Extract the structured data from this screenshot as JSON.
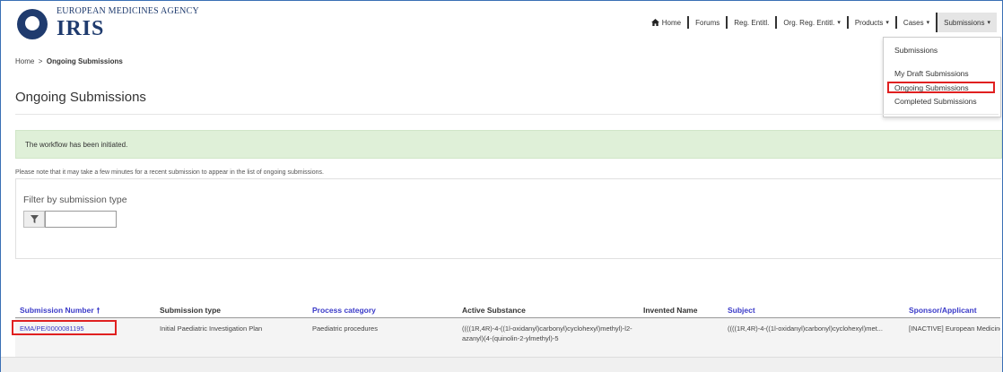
{
  "header": {
    "agency_name": "EUROPEAN MEDICINES AGENCY",
    "app_name": "IRIS"
  },
  "topnav": {
    "items": [
      {
        "label": "Home",
        "icon": "home-icon"
      },
      {
        "label": "Forums"
      },
      {
        "label": "Reg. Entitl."
      },
      {
        "label": "Org. Reg. Entitl.",
        "has_caret": true
      },
      {
        "label": "Products",
        "has_caret": true
      },
      {
        "label": "Cases",
        "has_caret": true
      },
      {
        "label": "Submissions",
        "has_caret": true,
        "active": true
      }
    ],
    "caret_glyph": "▾"
  },
  "submissions_menu": {
    "items": [
      "Submissions",
      "My Draft Submissions",
      "Ongoing Submissions",
      "Completed Submissions"
    ],
    "highlighted": "Ongoing Submissions"
  },
  "breadcrumb": {
    "home": "Home",
    "separator": ">",
    "current": "Ongoing Submissions"
  },
  "page": {
    "title": "Ongoing Submissions",
    "alert_message": "The workflow has been initiated.",
    "note": "Please note that it may take a few minutes for a recent submission to appear in the list of ongoing submissions."
  },
  "filter": {
    "label": "Filter by submission type",
    "input_value": "",
    "icon": "filter-icon"
  },
  "table": {
    "columns": [
      "Submission Number",
      "Submission type",
      "Process category",
      "Active Substance",
      "Invented Name",
      "Subject",
      "Sponsor/Applicant"
    ],
    "sort_indicator": "🠕",
    "sorted_column": "Submission Number",
    "rows": [
      {
        "submission_number": "EMA/PE/0000081195",
        "submission_type": "Initial Paediatric Investigation Plan",
        "process_category": "Paediatric procedures",
        "active_substance": "((((1R,4R)-4-((1l-oxidanyl)carbonyl)cyclohexyl)methyl)-l2-azanyl)(4-(quinolin-2-ylmethyl)-5",
        "invented_name": "",
        "subject": "((((1R,4R)-4-((1l-oxidanyl)carbonyl)cyclohexyl)met...",
        "sponsor_applicant": "[INACTIVE] European Medicines"
      }
    ]
  },
  "colors": {
    "brand": "#1f3b6e",
    "link": "#3a3ac8",
    "alert_bg": "#dff0d8",
    "highlight": "#e02020"
  }
}
